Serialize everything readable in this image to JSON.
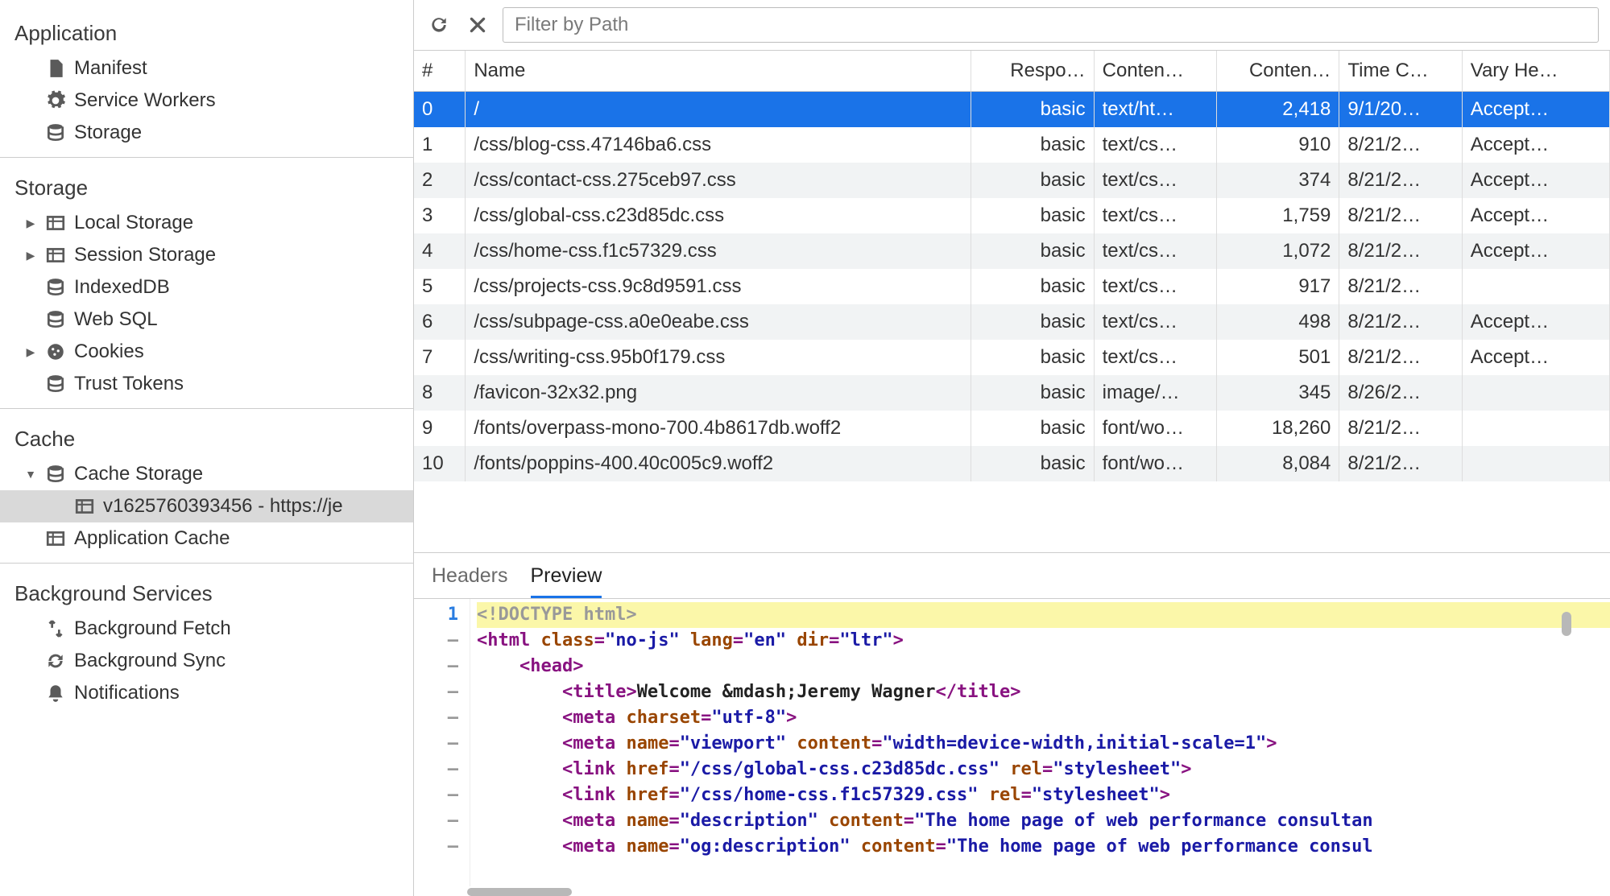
{
  "sidebar": {
    "application": {
      "title": "Application",
      "items": [
        {
          "label": "Manifest",
          "icon": "file-icon"
        },
        {
          "label": "Service Workers",
          "icon": "gear-icon"
        },
        {
          "label": "Storage",
          "icon": "database-icon"
        }
      ]
    },
    "storage": {
      "title": "Storage",
      "items": [
        {
          "label": "Local Storage",
          "icon": "table-icon",
          "disclosure": "closed"
        },
        {
          "label": "Session Storage",
          "icon": "table-icon",
          "disclosure": "closed"
        },
        {
          "label": "IndexedDB",
          "icon": "database-icon"
        },
        {
          "label": "Web SQL",
          "icon": "database-icon"
        },
        {
          "label": "Cookies",
          "icon": "cookie-icon",
          "disclosure": "closed"
        },
        {
          "label": "Trust Tokens",
          "icon": "database-icon"
        }
      ]
    },
    "cache": {
      "title": "Cache",
      "items": [
        {
          "label": "Cache Storage",
          "icon": "database-icon",
          "disclosure": "open",
          "children": [
            {
              "label": "v1625760393456 - https://je",
              "icon": "table-icon"
            }
          ]
        },
        {
          "label": "Application Cache",
          "icon": "table-icon"
        }
      ]
    },
    "background": {
      "title": "Background Services",
      "items": [
        {
          "label": "Background Fetch",
          "icon": "fetch-icon"
        },
        {
          "label": "Background Sync",
          "icon": "sync-icon"
        },
        {
          "label": "Notifications",
          "icon": "bell-icon"
        }
      ]
    }
  },
  "toolbar": {
    "filter_placeholder": "Filter by Path"
  },
  "table": {
    "columns": [
      "#",
      "Name",
      "Respo…",
      "Conten…",
      "Conten…",
      "Time C…",
      "Vary He…"
    ],
    "rows": [
      {
        "idx": "0",
        "name": "/",
        "resp": "basic",
        "ctype": "text/ht…",
        "clen": "2,418",
        "time": "9/1/20…",
        "vary": "Accept…"
      },
      {
        "idx": "1",
        "name": "/css/blog-css.47146ba6.css",
        "resp": "basic",
        "ctype": "text/cs…",
        "clen": "910",
        "time": "8/21/2…",
        "vary": "Accept…"
      },
      {
        "idx": "2",
        "name": "/css/contact-css.275ceb97.css",
        "resp": "basic",
        "ctype": "text/cs…",
        "clen": "374",
        "time": "8/21/2…",
        "vary": "Accept…"
      },
      {
        "idx": "3",
        "name": "/css/global-css.c23d85dc.css",
        "resp": "basic",
        "ctype": "text/cs…",
        "clen": "1,759",
        "time": "8/21/2…",
        "vary": "Accept…"
      },
      {
        "idx": "4",
        "name": "/css/home-css.f1c57329.css",
        "resp": "basic",
        "ctype": "text/cs…",
        "clen": "1,072",
        "time": "8/21/2…",
        "vary": "Accept…"
      },
      {
        "idx": "5",
        "name": "/css/projects-css.9c8d9591.css",
        "resp": "basic",
        "ctype": "text/cs…",
        "clen": "917",
        "time": "8/21/2…",
        "vary": ""
      },
      {
        "idx": "6",
        "name": "/css/subpage-css.a0e0eabe.css",
        "resp": "basic",
        "ctype": "text/cs…",
        "clen": "498",
        "time": "8/21/2…",
        "vary": "Accept…"
      },
      {
        "idx": "7",
        "name": "/css/writing-css.95b0f179.css",
        "resp": "basic",
        "ctype": "text/cs…",
        "clen": "501",
        "time": "8/21/2…",
        "vary": "Accept…"
      },
      {
        "idx": "8",
        "name": "/favicon-32x32.png",
        "resp": "basic",
        "ctype": "image/…",
        "clen": "345",
        "time": "8/26/2…",
        "vary": ""
      },
      {
        "idx": "9",
        "name": "/fonts/overpass-mono-700.4b8617db.woff2",
        "resp": "basic",
        "ctype": "font/wo…",
        "clen": "18,260",
        "time": "8/21/2…",
        "vary": ""
      },
      {
        "idx": "10",
        "name": "/fonts/poppins-400.40c005c9.woff2",
        "resp": "basic",
        "ctype": "font/wo…",
        "clen": "8,084",
        "time": "8/21/2…",
        "vary": ""
      }
    ],
    "selected_row_index": 0
  },
  "detail": {
    "tabs": {
      "headers": "Headers",
      "preview": "Preview",
      "active": "preview"
    },
    "code": {
      "lines": [
        {
          "n": "1",
          "gutter": "lnum",
          "tokens": [
            {
              "c": "t-doctype",
              "t": "<!DOCTYPE html>"
            }
          ],
          "hl": true
        },
        {
          "n": "–",
          "tokens": [
            {
              "c": "t-tag",
              "t": "<html "
            },
            {
              "c": "t-attr",
              "t": "class"
            },
            {
              "c": "t-tag",
              "t": "="
            },
            {
              "c": "t-val",
              "t": "\"no-js\""
            },
            {
              "c": "t-tag",
              "t": " "
            },
            {
              "c": "t-attr",
              "t": "lang"
            },
            {
              "c": "t-tag",
              "t": "="
            },
            {
              "c": "t-val",
              "t": "\"en\""
            },
            {
              "c": "t-tag",
              "t": " "
            },
            {
              "c": "t-attr",
              "t": "dir"
            },
            {
              "c": "t-tag",
              "t": "="
            },
            {
              "c": "t-val",
              "t": "\"ltr\""
            },
            {
              "c": "t-tag",
              "t": ">"
            }
          ]
        },
        {
          "n": "–",
          "indent": 1,
          "tokens": [
            {
              "c": "t-tag",
              "t": "<head>"
            }
          ]
        },
        {
          "n": "–",
          "indent": 2,
          "tokens": [
            {
              "c": "t-tag",
              "t": "<title>"
            },
            {
              "c": "t-text",
              "t": "Welcome &mdash;Jeremy Wagner"
            },
            {
              "c": "t-tag",
              "t": "</title>"
            }
          ]
        },
        {
          "n": "–",
          "indent": 2,
          "tokens": [
            {
              "c": "t-tag",
              "t": "<meta "
            },
            {
              "c": "t-attr",
              "t": "charset"
            },
            {
              "c": "t-tag",
              "t": "="
            },
            {
              "c": "t-val",
              "t": "\"utf-8\""
            },
            {
              "c": "t-tag",
              "t": ">"
            }
          ]
        },
        {
          "n": "–",
          "indent": 2,
          "tokens": [
            {
              "c": "t-tag",
              "t": "<meta "
            },
            {
              "c": "t-attr",
              "t": "name"
            },
            {
              "c": "t-tag",
              "t": "="
            },
            {
              "c": "t-val",
              "t": "\"viewport\""
            },
            {
              "c": "t-tag",
              "t": " "
            },
            {
              "c": "t-attr",
              "t": "content"
            },
            {
              "c": "t-tag",
              "t": "="
            },
            {
              "c": "t-val",
              "t": "\"width=device-width,initial-scale=1\""
            },
            {
              "c": "t-tag",
              "t": ">"
            }
          ]
        },
        {
          "n": "–",
          "indent": 2,
          "tokens": [
            {
              "c": "t-tag",
              "t": "<link "
            },
            {
              "c": "t-attr",
              "t": "href"
            },
            {
              "c": "t-tag",
              "t": "="
            },
            {
              "c": "t-val",
              "t": "\"/css/global-css.c23d85dc.css\""
            },
            {
              "c": "t-tag",
              "t": " "
            },
            {
              "c": "t-attr",
              "t": "rel"
            },
            {
              "c": "t-tag",
              "t": "="
            },
            {
              "c": "t-val",
              "t": "\"stylesheet\""
            },
            {
              "c": "t-tag",
              "t": ">"
            }
          ]
        },
        {
          "n": "–",
          "indent": 2,
          "tokens": [
            {
              "c": "t-tag",
              "t": "<link "
            },
            {
              "c": "t-attr",
              "t": "href"
            },
            {
              "c": "t-tag",
              "t": "="
            },
            {
              "c": "t-val",
              "t": "\"/css/home-css.f1c57329.css\""
            },
            {
              "c": "t-tag",
              "t": " "
            },
            {
              "c": "t-attr",
              "t": "rel"
            },
            {
              "c": "t-tag",
              "t": "="
            },
            {
              "c": "t-val",
              "t": "\"stylesheet\""
            },
            {
              "c": "t-tag",
              "t": ">"
            }
          ]
        },
        {
          "n": "–",
          "indent": 2,
          "tokens": [
            {
              "c": "t-tag",
              "t": "<meta "
            },
            {
              "c": "t-attr",
              "t": "name"
            },
            {
              "c": "t-tag",
              "t": "="
            },
            {
              "c": "t-val",
              "t": "\"description\""
            },
            {
              "c": "t-tag",
              "t": " "
            },
            {
              "c": "t-attr",
              "t": "content"
            },
            {
              "c": "t-tag",
              "t": "="
            },
            {
              "c": "t-val",
              "t": "\"The home page of web performance consultan"
            }
          ]
        },
        {
          "n": "–",
          "indent": 2,
          "tokens": [
            {
              "c": "t-tag",
              "t": "<meta "
            },
            {
              "c": "t-attr",
              "t": "name"
            },
            {
              "c": "t-tag",
              "t": "="
            },
            {
              "c": "t-val",
              "t": "\"og:description\""
            },
            {
              "c": "t-tag",
              "t": " "
            },
            {
              "c": "t-attr",
              "t": "content"
            },
            {
              "c": "t-tag",
              "t": "="
            },
            {
              "c": "t-val",
              "t": "\"The home page of web performance consul"
            }
          ]
        }
      ]
    }
  }
}
